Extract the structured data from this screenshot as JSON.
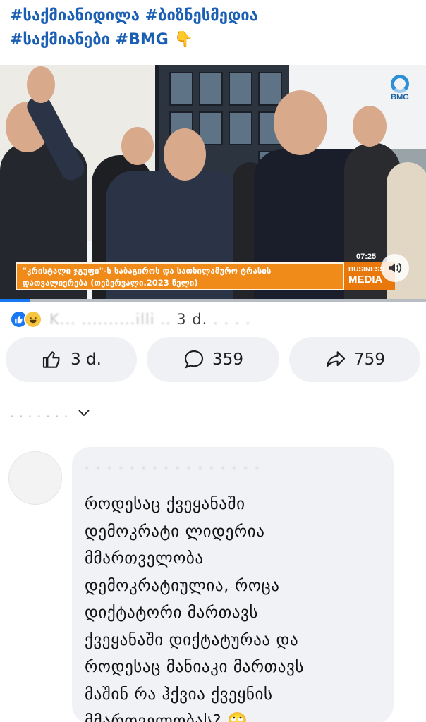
{
  "post": {
    "hashtags_line1": "#საქმიანიდილა #ბიზნესმედია",
    "hashtags_line2": "#საქმიანები #BMG",
    "point_emoji": "👇"
  },
  "video": {
    "channel_logo": "BMG",
    "caption": "\"კრისტალი ჯგუფი\"-ს საბაგიროს და სათხილამურო ტრასის დათვალიერება (თებერვალი.2023 წელი)",
    "timecode": "07:25",
    "badge_line1": "BUSINESS",
    "badge_line2": "MEDIA",
    "progress_fraction": 0.07,
    "icons": [
      "bmg-logo-icon",
      "speaker-icon"
    ]
  },
  "reactions": {
    "icons": [
      "like-reaction-icon",
      "haha-reaction-icon"
    ],
    "obscured_names_left": "K...",
    "obscured_names_mid": "..........illi ..",
    "time": "3 d.",
    "obscured_tail": ". . . ."
  },
  "actions": {
    "like_label": "3 d.",
    "comment_count": "359",
    "share_count": "759"
  },
  "comments_header": {
    "obscured_label": ". .  . . . . .",
    "chevron": "⌄"
  },
  "comment": {
    "author_obscured": ". . . . . . . . . . . . . . . .",
    "text": "როდესაც ქვეყანაში\nდემოკრატი ლიდერია\nმმართველობა\nდემოკრატიულია, როცა\nდიქტატორი მართავს\nქვეყანაში დიქტატურაა და\nროდესაც მანიაკი მართავს\nმაშინ რა ჰქვია ქვეყნის\nმმართველობას? 🙄"
  }
}
